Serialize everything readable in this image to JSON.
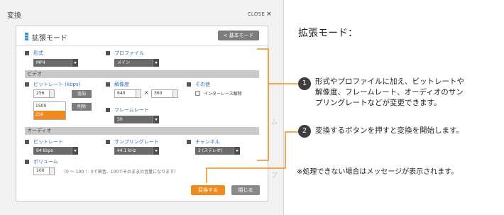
{
  "dialog": {
    "title": "変換",
    "close_label": "CLOSE",
    "close_icon": "×",
    "panel_title": "拡張モード",
    "basic_mode_button": "< 基本モード"
  },
  "format": {
    "label": "形式",
    "value": "MP4"
  },
  "profile": {
    "label": "プロファイル",
    "value": "メイン"
  },
  "video": {
    "section": "ビデオ",
    "bitrate": {
      "label": "ビットレート (kbps)",
      "value": "256",
      "add_button": "追加",
      "delete_button": "削除",
      "options": [
        "1500",
        "256"
      ],
      "selected": "256"
    },
    "resolution": {
      "label": "解像度",
      "width": "640",
      "times": "×",
      "height": "360"
    },
    "framerate": {
      "label": "フレームレート",
      "value": "30"
    },
    "other": {
      "label": "その他",
      "interlace_label": "インターレース解除"
    }
  },
  "audio": {
    "section": "オーディオ",
    "bitrate": {
      "label": "ビットレート",
      "value": "64 kbps"
    },
    "sampling": {
      "label": "サンプリングレート",
      "value": "44.1 kHz"
    },
    "channel": {
      "label": "チャンネル",
      "value": "2 (ステレオ)"
    },
    "volume": {
      "label": "ボリューム",
      "value": "100",
      "note": "（0 ～ 100 ： 0で無音、100でそのままの音量になります）"
    }
  },
  "footer": {
    "convert_button": "変換する",
    "close_button": "閉じる"
  },
  "explanation": {
    "title": "拡張モード：",
    "step1_number": "1",
    "step1_lines": [
      "形式やプロファイルに加え、ビットレートや",
      "解像度、フレームレート、オーディオのサン",
      "プリングレートなどが変更できます。"
    ],
    "step2_number": "2",
    "step2_text": "変換するボタンを押すと変換を開始します。",
    "footnote": "※処理できない場合はメッセージが表示されます。"
  },
  "colors": {
    "accent": "#f08a1c",
    "link_blue": "#2a6fb5",
    "icon_blue": "#2f8fd8"
  }
}
